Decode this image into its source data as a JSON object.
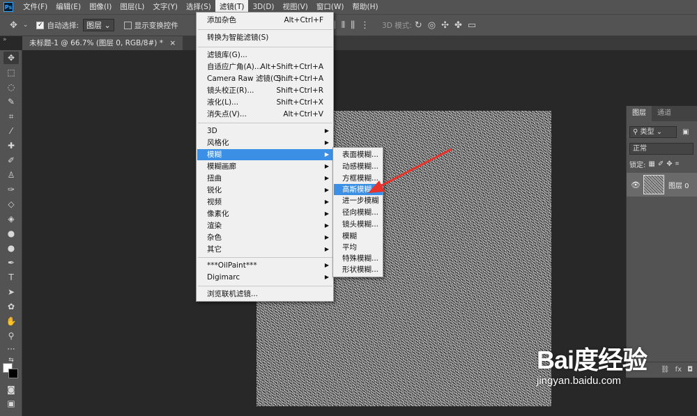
{
  "menubar": {
    "logo": "Ps",
    "items": [
      "文件(F)",
      "编辑(E)",
      "图像(I)",
      "图层(L)",
      "文字(Y)",
      "选择(S)",
      "滤镜(T)",
      "3D(D)",
      "视图(V)",
      "窗口(W)",
      "帮助(H)"
    ]
  },
  "options": {
    "auto_select_label": "自动选择:",
    "layer_select": "图层",
    "show_transform_label": "显示变换控件",
    "mode_3d_label": "3D 模式:"
  },
  "document_tab": {
    "title": "未标题-1 @ 66.7% (图层 0, RGB/8#) *"
  },
  "filter_menu": {
    "items": [
      {
        "label": "添加杂色",
        "shortcut": "Alt+Ctrl+F"
      },
      {
        "label": "转换为智能滤镜(S)",
        "shortcut": ""
      },
      {
        "label": "滤镜库(G)...",
        "shortcut": ""
      },
      {
        "label": "自适应广角(A)...",
        "shortcut": "Alt+Shift+Ctrl+A"
      },
      {
        "label": "Camera Raw 滤镜(C)...",
        "shortcut": "Shift+Ctrl+A"
      },
      {
        "label": "镜头校正(R)...",
        "shortcut": "Shift+Ctrl+R"
      },
      {
        "label": "液化(L)...",
        "shortcut": "Shift+Ctrl+X"
      },
      {
        "label": "消失点(V)...",
        "shortcut": "Alt+Ctrl+V"
      },
      {
        "label": "3D",
        "shortcut": ""
      },
      {
        "label": "风格化",
        "shortcut": ""
      },
      {
        "label": "模糊",
        "shortcut": ""
      },
      {
        "label": "模糊画廊",
        "shortcut": ""
      },
      {
        "label": "扭曲",
        "shortcut": ""
      },
      {
        "label": "锐化",
        "shortcut": ""
      },
      {
        "label": "视频",
        "shortcut": ""
      },
      {
        "label": "像素化",
        "shortcut": ""
      },
      {
        "label": "渲染",
        "shortcut": ""
      },
      {
        "label": "杂色",
        "shortcut": ""
      },
      {
        "label": "其它",
        "shortcut": ""
      },
      {
        "label": "***OilPaint***",
        "shortcut": ""
      },
      {
        "label": "Digimarc",
        "shortcut": ""
      },
      {
        "label": "浏览联机滤镜...",
        "shortcut": ""
      }
    ]
  },
  "blur_submenu": {
    "items": [
      "表面模糊...",
      "动感模糊...",
      "方框模糊...",
      "高斯模糊...",
      "进一步模糊",
      "径向模糊...",
      "镜头模糊...",
      "模糊",
      "平均",
      "特殊模糊...",
      "形状模糊..."
    ]
  },
  "layers_panel": {
    "tabs": [
      "图层",
      "通道"
    ],
    "filter_kind": "类型",
    "blend_mode": "正常",
    "lock_label": "锁定:",
    "layer_name": "图层 0",
    "footer_fx": "fx"
  },
  "watermark": {
    "brand": "Bai度经验",
    "url": "jingyan.baidu.com"
  },
  "colors": {
    "highlight": "#3b8fe5",
    "arrow": "#e8332b"
  }
}
